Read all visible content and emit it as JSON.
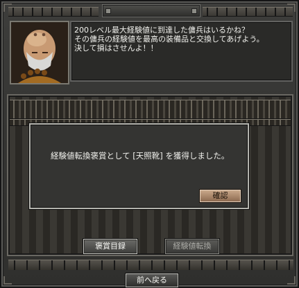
{
  "npc": {
    "message_lines": "200レベル最大経験値に到達した傭兵はいるかね？\nその傭兵の経験値を最高の装備品と交換してあげよう。\n決して損はさせんよ！！"
  },
  "dialog": {
    "text": "経験値転換褒賞として [天照靴] を獲得しました。",
    "confirm_label": "確認"
  },
  "buttons": {
    "reward_list": "褒賞目録",
    "exp_convert": "経験値転換",
    "back": "前へ戻る"
  }
}
